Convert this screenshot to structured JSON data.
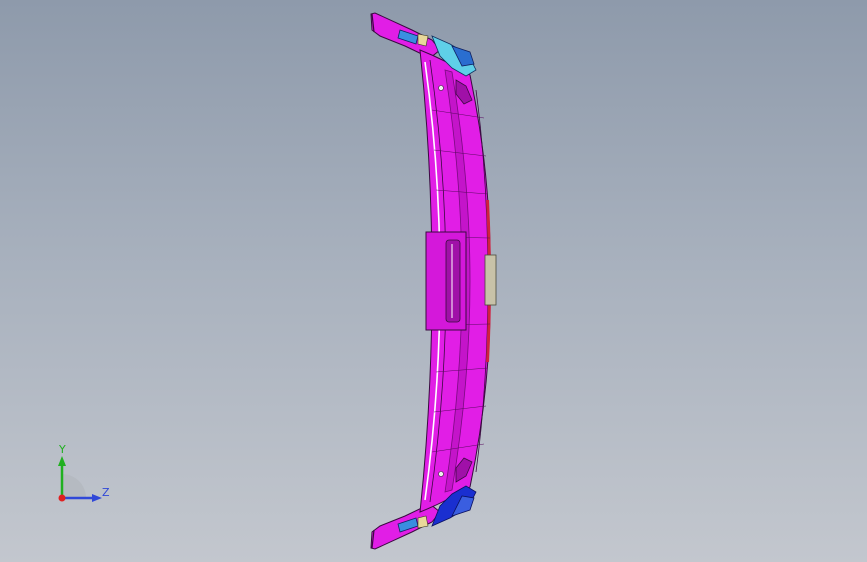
{
  "triad": {
    "y_label": "Y",
    "z_label": "Z"
  },
  "colors": {
    "background_top": "#8e9aab",
    "background_bottom": "#c3c7ce",
    "part_main": "#e11ee6",
    "part_dark": "#a010a8",
    "part_edge": "#3a0a40",
    "clip_blue": "#3a8ee0",
    "clip_cyan": "#5fd0e8",
    "clip_dark_blue": "#1a2fd0",
    "bracket_gray": "#c8c2a8",
    "accent_red": "#d02040",
    "axis_y": "#20b020",
    "axis_z": "#3048d8",
    "axis_x": "#e02020"
  }
}
